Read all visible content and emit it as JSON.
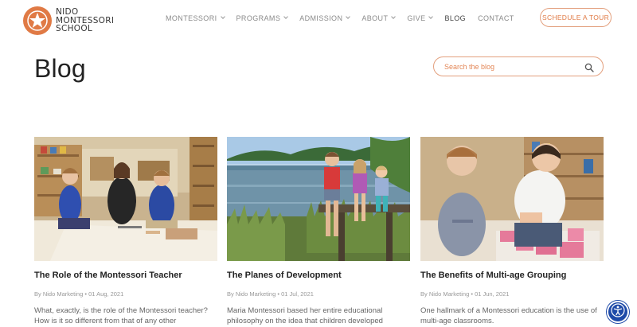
{
  "logo": {
    "line1": "NIDO",
    "line2": "MONTESSORI",
    "line3": "SCHOOL"
  },
  "nav": [
    {
      "label": "MONTESSORI",
      "dropdown": true
    },
    {
      "label": "PROGRAMS",
      "dropdown": true
    },
    {
      "label": "ADMISSION",
      "dropdown": true
    },
    {
      "label": "ABOUT",
      "dropdown": true
    },
    {
      "label": "GIVE",
      "dropdown": true
    },
    {
      "label": "BLOG",
      "dropdown": false
    },
    {
      "label": "CONTACT",
      "dropdown": false
    }
  ],
  "header": {
    "cta_label": "SCHEDULE A TOUR"
  },
  "page": {
    "title": "Blog"
  },
  "search": {
    "placeholder": "Search the blog"
  },
  "posts": [
    {
      "title": "The Role of the Montessori Teacher",
      "meta": "By Nido Marketing • 01 Aug, 2021",
      "excerpt": "What, exactly, is the role of the Montessori teacher? How is it so different from that of any other"
    },
    {
      "title": "The Planes of Development",
      "meta": "By Nido Marketing • 01 Jul, 2021",
      "excerpt": "Maria Montessori based her entire educational philosophy on the idea that children developed"
    },
    {
      "title": "The Benefits of Multi-age Grouping",
      "meta": "By Nido Marketing • 01 Jun, 2021",
      "excerpt": "One hallmark of a Montessori education is the use of multi-age classrooms."
    }
  ],
  "colors": {
    "accent": "#e07a45",
    "accessibility": "#1e4aa8"
  },
  "icons": {
    "search": "search-icon",
    "accessibility": "accessibility-icon"
  }
}
